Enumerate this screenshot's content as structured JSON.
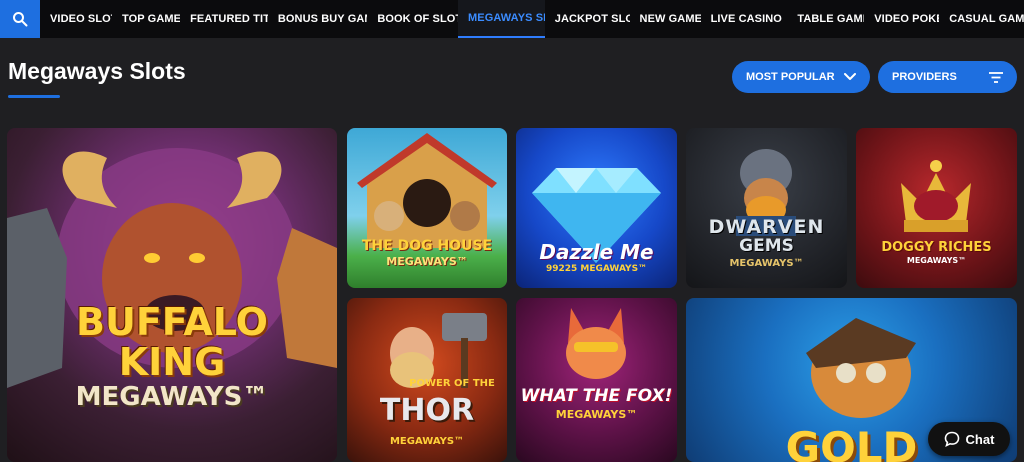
{
  "nav": {
    "items": [
      {
        "label": "VIDEO SLOTS",
        "active": false
      },
      {
        "label": "TOP GAMES",
        "active": false
      },
      {
        "label": "FEATURED TITLES",
        "active": false
      },
      {
        "label": "BONUS BUY GAMES",
        "active": false
      },
      {
        "label": "BOOK OF SLOTS",
        "active": false
      },
      {
        "label": "MEGAWAYS SLOTS",
        "active": true
      },
      {
        "label": "JACKPOT SLOTS",
        "active": false
      },
      {
        "label": "NEW GAMES",
        "active": false
      },
      {
        "label": "LIVE CASINO",
        "active": false
      },
      {
        "label": "TABLE GAMES",
        "active": false
      },
      {
        "label": "VIDEO POKER",
        "active": false
      },
      {
        "label": "CASUAL GAMES",
        "active": false
      }
    ]
  },
  "page": {
    "title": "Megaways Slots",
    "sort_label": "MOST POPULAR",
    "providers_label": "PROVIDERS"
  },
  "games": {
    "buffalo": {
      "line1": "BUFFALO",
      "line2": "KING",
      "line3": "MEGAWAYS™"
    },
    "doghouse": {
      "line1": "THE DOG HOUSE",
      "line2": "MEGAWAYS™"
    },
    "dazzle": {
      "line1": "Dazzle Me",
      "line2": "99225 MEGAWAYS™"
    },
    "dwarven": {
      "line1": "DWARVEN",
      "line2": "GEMS",
      "line3": "MEGAWAYS™"
    },
    "doggy": {
      "line1": "DOGGY RICHES",
      "line2": "MEGAWAYS™"
    },
    "thor": {
      "line1": "POWER OF THE",
      "line2": "THOR",
      "line3": "MEGAWAYS™"
    },
    "fox": {
      "line1": "WHAT THE FOX!",
      "line2": "MEGAWAYS™"
    },
    "gold": {
      "line1": "GOLD"
    }
  },
  "chat": {
    "label": "Chat"
  },
  "colors": {
    "accent": "#1e6fe0",
    "background": "#1f1f22",
    "nav_bg": "#0b0b0d",
    "active_nav": "#3b8cff"
  }
}
